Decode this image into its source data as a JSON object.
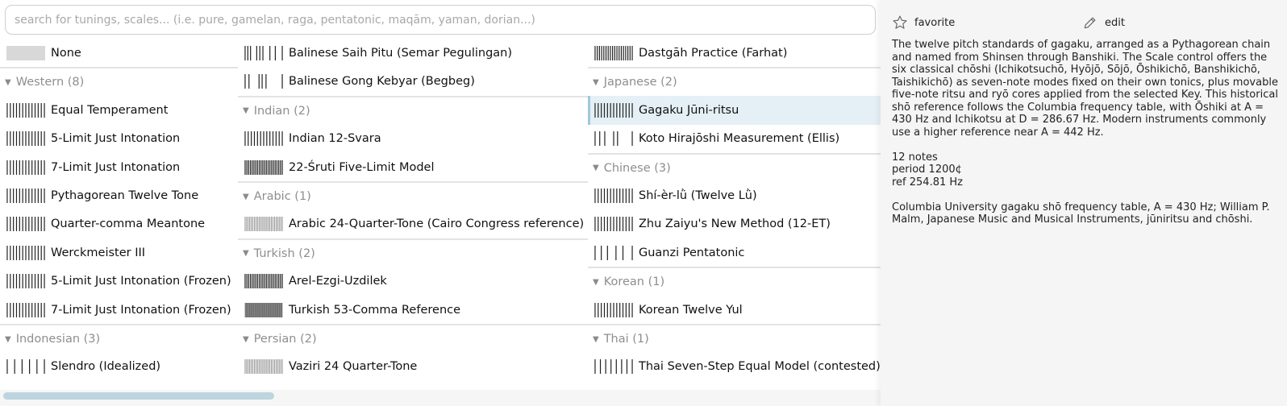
{
  "search": {
    "placeholder": "search for tunings, scales... (i.e. pure, gamelan, raga, pentatonic, maqām, yaman, dorian...)"
  },
  "columns": [
    [
      {
        "kind": "item",
        "label": "None",
        "swatch": "none"
      },
      {
        "kind": "group",
        "label": "Western (8)"
      },
      {
        "kind": "item",
        "label": "Equal Temperament",
        "swatch": "twelve"
      },
      {
        "kind": "item",
        "label": "5-Limit Just Intonation",
        "swatch": "twelve"
      },
      {
        "kind": "item",
        "label": "7-Limit Just Intonation",
        "swatch": "twelve"
      },
      {
        "kind": "item",
        "label": "Pythagorean Twelve Tone",
        "swatch": "twelve"
      },
      {
        "kind": "item",
        "label": "Quarter-comma Meantone",
        "swatch": "twelve"
      },
      {
        "kind": "item",
        "label": "Werckmeister III",
        "swatch": "twelve"
      },
      {
        "kind": "item",
        "label": "5-Limit Just Intonation (Frozen)",
        "swatch": "twelve"
      },
      {
        "kind": "item",
        "label": "7-Limit Just Intonation (Frozen)",
        "swatch": "twelve"
      },
      {
        "kind": "group",
        "label": "Indonesian (3)"
      },
      {
        "kind": "item",
        "label": "Slendro (Idealized)",
        "swatch": "five"
      }
    ],
    [
      {
        "kind": "item",
        "label": "Balinese Saih Pitu (Semar Pegulingan)",
        "swatch": "pitu"
      },
      {
        "kind": "item",
        "label": "Balinese Gong Kebyar (Begbeg)",
        "swatch": "kebyar"
      },
      {
        "kind": "group",
        "label": "Indian (2)"
      },
      {
        "kind": "item",
        "label": "Indian 12-Svara",
        "swatch": "twelve"
      },
      {
        "kind": "item",
        "label": "22-Śruti Five-Limit Model",
        "swatch": "twentytwo"
      },
      {
        "kind": "group",
        "label": "Arabic (1)"
      },
      {
        "kind": "item",
        "label": "Arabic 24-Quarter-Tone (Cairo Congress reference)",
        "swatch": "dense24"
      },
      {
        "kind": "group",
        "label": "Turkish (2)"
      },
      {
        "kind": "item",
        "label": "Arel-Ezgi-Uzdilek",
        "swatch": "twentytwo"
      },
      {
        "kind": "item",
        "label": "Turkish 53-Comma Reference",
        "swatch": "solid"
      },
      {
        "kind": "group",
        "label": "Persian (2)"
      },
      {
        "kind": "item",
        "label": "Vaziri 24 Quarter-Tone",
        "swatch": "dense24"
      }
    ],
    [
      {
        "kind": "item",
        "label": "Dastgāh Practice (Farhat)",
        "swatch": "dense17"
      },
      {
        "kind": "group",
        "label": "Japanese (2)"
      },
      {
        "kind": "item",
        "label": "Gagaku Jūni-ritsu",
        "swatch": "twelve",
        "selected": true
      },
      {
        "kind": "item",
        "label": "Koto Hirajōshi Measurement (Ellis)",
        "swatch": "koto"
      },
      {
        "kind": "group",
        "label": "Chinese (3)"
      },
      {
        "kind": "item",
        "label": "Shí-èr-lǜ (Twelve Lǜ)",
        "swatch": "twelve"
      },
      {
        "kind": "item",
        "label": "Zhu Zaiyu's New Method (12-ET)",
        "swatch": "twelve"
      },
      {
        "kind": "item",
        "label": "Guanzi Pentatonic",
        "swatch": "guanzi"
      },
      {
        "kind": "group",
        "label": "Korean (1)"
      },
      {
        "kind": "item",
        "label": "Korean Twelve Yul",
        "swatch": "twelve"
      },
      {
        "kind": "group",
        "label": "Thai (1)"
      },
      {
        "kind": "item",
        "label": "Thai Seven-Step Equal Model (contested)",
        "swatch": "seven"
      }
    ]
  ],
  "detail": {
    "favorite_label": "favorite",
    "edit_label": "edit",
    "description": "The twelve pitch standards of gagaku, arranged as a Pythagorean chain and named from Shinsen through Banshiki. The Scale control offers the six classical chōshi (Ichikotsuchō, Hyōjō, Sōjō, Ōshikichō, Banshikichō, Taishikichō) as seven-note modes fixed on their own tonics, plus movable five-note ritsu and ryō cores applied from the selected Key. This historical shō reference follows the Columbia frequency table, with Ōshiki at A = 430 Hz and Ichikotsu at D = 286.67 Hz. Modern instruments commonly use a higher reference near A = 442 Hz.",
    "notes": "12 notes",
    "period": "period 1200¢",
    "ref": "ref 254.81 Hz",
    "source": "Columbia University gagaku shō frequency table, A = 430 Hz; William P. Malm, Japanese Music and Musical Instruments, jūniritsu and chōshi."
  }
}
